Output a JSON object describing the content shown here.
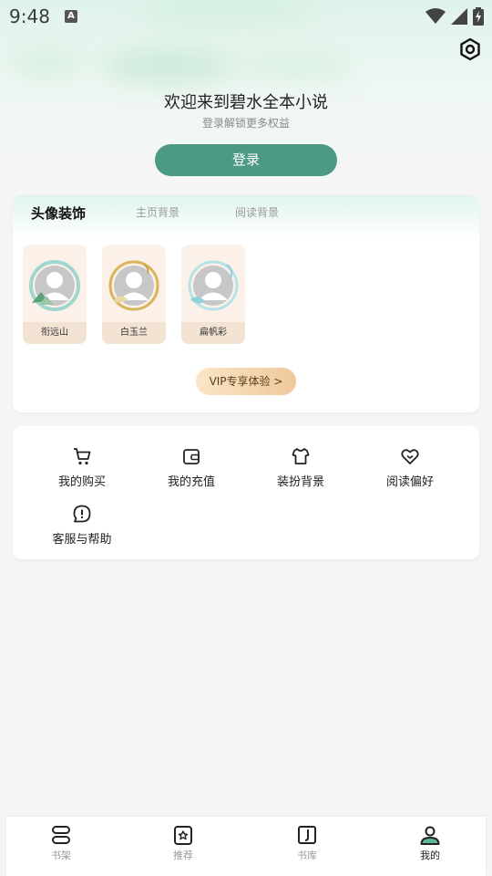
{
  "status_bar": {
    "time": "9:48",
    "indicator": "A"
  },
  "header": {
    "title": "欢迎来到碧水全本小说",
    "subtitle": "登录解锁更多权益",
    "login_label": "登录"
  },
  "decoration": {
    "tabs": [
      {
        "label": "头像装饰",
        "active": true
      },
      {
        "label": "主页背景",
        "active": false
      },
      {
        "label": "阅读背景",
        "active": false
      }
    ],
    "avatars": [
      {
        "label": "衔远山"
      },
      {
        "label": "白玉兰"
      },
      {
        "label": "扁帆彩"
      }
    ],
    "vip_label": "VIP专享体验 >"
  },
  "functions": [
    {
      "label": "我的购买",
      "icon": "cart-icon"
    },
    {
      "label": "我的充值",
      "icon": "wallet-icon"
    },
    {
      "label": "装扮背景",
      "icon": "shirt-icon"
    },
    {
      "label": "阅读偏好",
      "icon": "heart-icon"
    },
    {
      "label": "客服与帮助",
      "icon": "help-icon"
    }
  ],
  "bottom_nav": [
    {
      "label": "书架",
      "icon": "bookshelf-icon",
      "active": false
    },
    {
      "label": "推荐",
      "icon": "recommend-icon",
      "active": false
    },
    {
      "label": "书库",
      "icon": "library-icon",
      "active": false
    },
    {
      "label": "我的",
      "icon": "profile-icon",
      "active": true
    }
  ],
  "colors": {
    "accent": "#4d9a84",
    "vip": "#efc89a"
  }
}
